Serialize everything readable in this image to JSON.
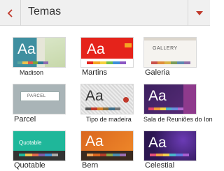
{
  "header": {
    "title": "Temas",
    "back_icon": "chevron-left-icon",
    "dropdown_icon": "caret-down-icon"
  },
  "accent": "#c0392b",
  "themes": [
    {
      "name": "Madison",
      "sample_text": "Aa"
    },
    {
      "name": "Martins",
      "sample_text": "Aa"
    },
    {
      "name": "Galeria",
      "sample_text": "GALLERY"
    },
    {
      "name": "Parcel",
      "sample_text": "PARCEL"
    },
    {
      "name": "Tipo de madeira",
      "sample_text": "Aa"
    },
    {
      "name": "Sala de Reuniões do Ion",
      "sample_text": "Aa"
    },
    {
      "name": "Quotable",
      "sample_text": "Quotable"
    },
    {
      "name": "Bern",
      "sample_text": "Aa"
    },
    {
      "name": "Celestial",
      "sample_text": "Aa"
    }
  ]
}
